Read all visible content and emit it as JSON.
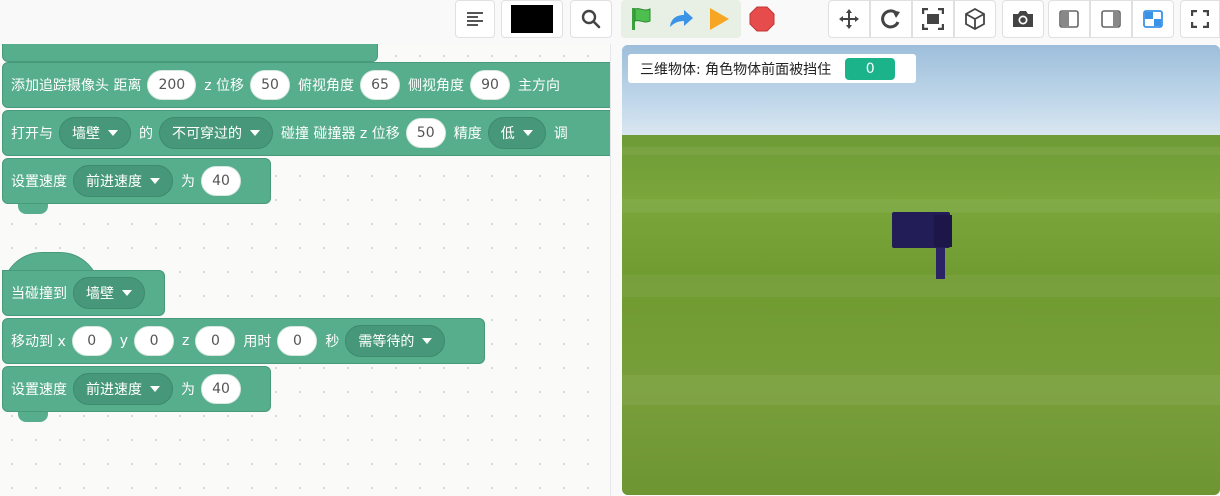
{
  "toolbar": {
    "format_icon": "align-left-icon",
    "color_value": "#000000",
    "search_icon": "search-icon",
    "run_icons": [
      "green-flag-icon",
      "step-arrow-icon",
      "play-icon",
      "stop-icon"
    ],
    "view_icons": [
      "move-icon",
      "rotate-icon",
      "fit-screen-icon",
      "cube-icon"
    ],
    "camera_icon": "camera-icon",
    "layout_icons": [
      "layout-left-icon",
      "layout-right-icon",
      "layout-small-stage-icon"
    ],
    "fullscreen_icon": "fullscreen-icon"
  },
  "blocks": {
    "camera": {
      "label1": "添加追踪摄像头 距离",
      "distance": "200",
      "label2": "z 位移",
      "z_offset": "50",
      "label3": "俯视角度",
      "pitch": "65",
      "label4": "侧视角度",
      "yaw": "90",
      "label5": "主方向"
    },
    "collider": {
      "label1": "打开与",
      "target": "墙壁",
      "label2": "的",
      "type": "不可穿过的",
      "label3": "碰撞 碰撞器 z 位移",
      "z_offset": "50",
      "label4": "精度",
      "precision": "低",
      "label5": "调"
    },
    "speed1": {
      "label1": "设置速度",
      "field": "前进速度",
      "label2": "为",
      "value": "40"
    },
    "when_hit": {
      "label": "当碰撞到",
      "target": "墙壁"
    },
    "move": {
      "label1": "移动到 x",
      "x": "0",
      "label2": "y",
      "y": "0",
      "label3": "z",
      "z": "0",
      "label4": "用时",
      "time": "0",
      "label5": "秒",
      "mode": "需等待的"
    },
    "speed2": {
      "label1": "设置速度",
      "field": "前进速度",
      "label2": "为",
      "value": "40"
    }
  },
  "stage": {
    "hud_label": "三维物体: 角色物体前面被挡住",
    "hud_value": "0",
    "hud_value_color": "#1ab38a",
    "object_color": "#221c57"
  }
}
